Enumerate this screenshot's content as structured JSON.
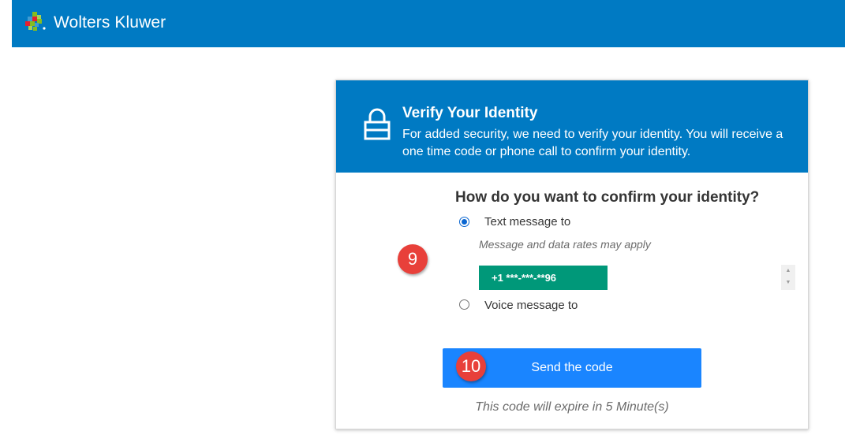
{
  "brand": {
    "name": "Wolters Kluwer",
    "bar_color": "#007ac3"
  },
  "card": {
    "header": {
      "title": "Verify Your Identity",
      "description": "For added security, we need to verify your identity. You will receive a one time code or phone call to confirm your identity.",
      "icon": "lock-icon"
    },
    "question": "How do you want to confirm your identity?",
    "options": [
      {
        "label": "Text message to",
        "selected": true
      },
      {
        "label": "Voice message to",
        "selected": false
      }
    ],
    "rates_note": "Message and data rates may apply",
    "phone_number": "+1 ***-***-**96",
    "send_button_label": "Send the code",
    "expire_note": "This code will expire in 5 Minute(s)"
  },
  "annotations": {
    "step_9": "9",
    "step_10": "10",
    "badge_color": "#e8403a"
  },
  "colors": {
    "header_bg": "#007ac3",
    "phone_bg": "#009879",
    "button_bg": "#1a85ff"
  }
}
